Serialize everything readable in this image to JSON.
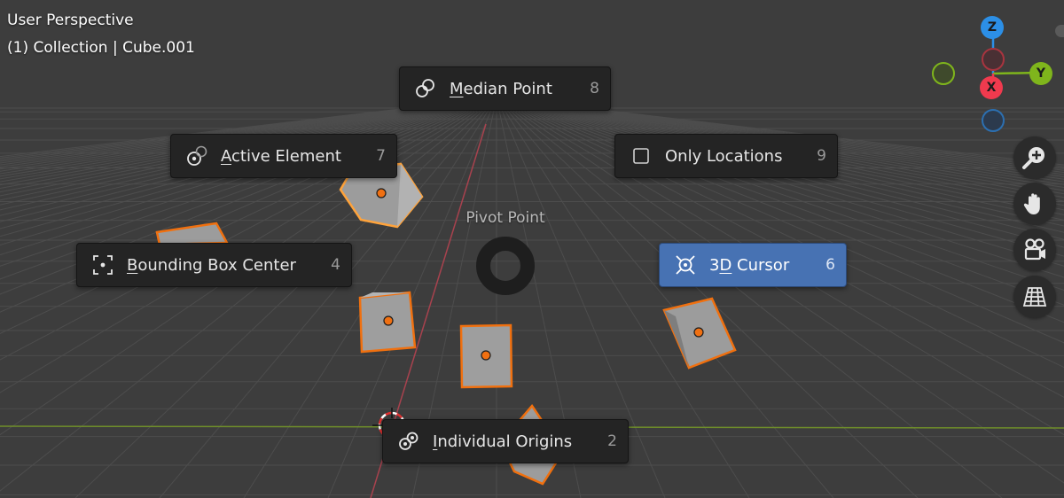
{
  "viewport": {
    "title": "User Perspective",
    "context": "(1) Collection | Cube.001"
  },
  "pie_menu": {
    "title": "Pivot Point",
    "items": [
      {
        "id": "median-point",
        "before": "",
        "accel": "M",
        "after": "edian Point",
        "key": "8",
        "icon": "median-point-icon",
        "active": false
      },
      {
        "id": "active-element",
        "before": "",
        "accel": "A",
        "after": "ctive Element",
        "key": "7",
        "icon": "active-element-icon",
        "active": false
      },
      {
        "id": "only-locations",
        "before": "Only Locations",
        "accel": "",
        "after": "",
        "key": "9",
        "icon": "checkbox-icon",
        "active": false
      },
      {
        "id": "bounding-box-center",
        "before": "",
        "accel": "B",
        "after": "ounding Box Center",
        "key": "4",
        "icon": "bounding-box-icon",
        "active": false
      },
      {
        "id": "3d-cursor",
        "before": "3",
        "accel": "D",
        "after": " Cursor",
        "key": "6",
        "icon": "3d-cursor-icon",
        "active": true
      },
      {
        "id": "individual-origins",
        "before": "",
        "accel": "I",
        "after": "ndividual Origins",
        "key": "2",
        "icon": "individual-origins-icon",
        "active": false
      }
    ]
  },
  "gizmo": {
    "z_label": "Z",
    "x_label": "X",
    "y_label": "Y",
    "colors": {
      "x": "#f03a4e",
      "y": "#7fb51c",
      "z": "#2c8fe6"
    }
  },
  "nav_buttons": [
    {
      "id": "zoom",
      "icon": "zoom-in-icon"
    },
    {
      "id": "pan",
      "icon": "hand-icon"
    },
    {
      "id": "camera",
      "icon": "camera-icon"
    },
    {
      "id": "ortho",
      "icon": "grid-icon"
    }
  ],
  "colors": {
    "background": "#3d3d3d",
    "grid": "#4a4a4a",
    "selection_outline": "#f0700f",
    "active_outline": "#ffa33b",
    "cube_face": "#9e9e9e",
    "active_item": "#4772b3"
  }
}
